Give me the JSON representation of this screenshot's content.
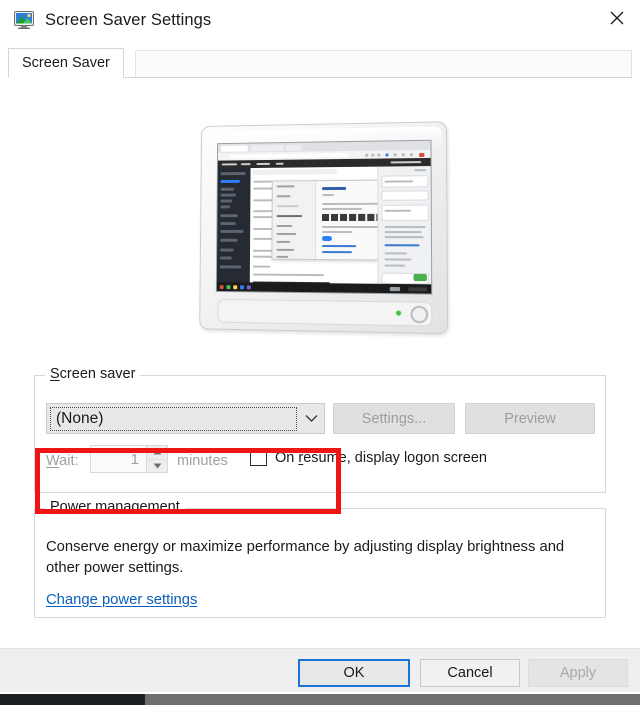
{
  "window": {
    "title": "Screen Saver Settings",
    "icon": "monitor-screensaver-icon",
    "close_label": "✕"
  },
  "tabs": [
    {
      "label": "Screen Saver",
      "selected": true
    }
  ],
  "preview": {
    "name": "monitor-preview",
    "description": "Monitor showing a blurred screenshot of a browser window with a settings dialog"
  },
  "screen_saver_group": {
    "title_prefix": "S",
    "title_rest": "creen saver",
    "combo": {
      "name": "screen-saver-select",
      "value": "(None)",
      "options": [
        "(None)"
      ],
      "focused": true
    },
    "settings_button": {
      "label": "Settings...",
      "accel": "t",
      "disabled": true
    },
    "preview_button": {
      "label": "Preview",
      "accel": "v",
      "disabled": true
    },
    "wait": {
      "label_prefix": "W",
      "label_rest": "ait:",
      "value": "1",
      "units": "minutes",
      "disabled": true
    },
    "on_resume": {
      "label_part1": "On ",
      "label_accel": "r",
      "label_part2": "esume, display logon screen",
      "checked": false
    }
  },
  "power_group": {
    "title": "Power management",
    "description": "Conserve energy or maximize performance by adjusting display brightness and other power settings.",
    "link": "Change power settings",
    "link_color": "#0a5fbf"
  },
  "footer": {
    "ok": {
      "label": "OK",
      "default": true
    },
    "cancel": {
      "label": "Cancel"
    },
    "apply": {
      "label": "Apply",
      "accel": "A",
      "disabled": true
    }
  },
  "annotation": {
    "name": "red-highlight-box",
    "color": "#f01515",
    "targets": "screen saver dropdown"
  },
  "scrollbar": {
    "name": "horizontal-scrollbar",
    "thumb_color": "#1c2024",
    "track_color": "#6e6e6e"
  }
}
